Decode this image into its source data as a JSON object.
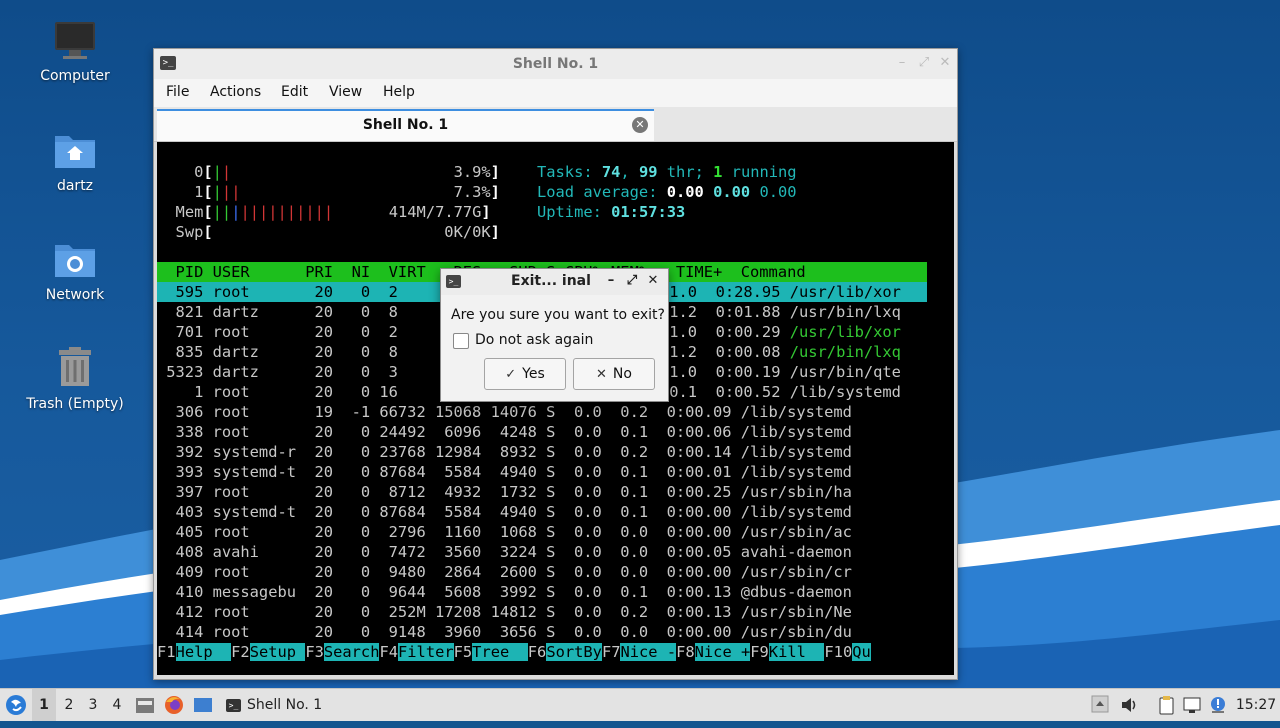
{
  "desktop": {
    "icons": [
      {
        "label": "Computer",
        "icon": "computer-icon"
      },
      {
        "label": "dartz",
        "icon": "home-folder-icon"
      },
      {
        "label": "Network",
        "icon": "network-folder-icon"
      },
      {
        "label": "Trash (Empty)",
        "icon": "trash-icon"
      }
    ]
  },
  "window": {
    "title": "Shell No. 1",
    "menu": [
      "File",
      "Actions",
      "Edit",
      "View",
      "Help"
    ],
    "tab_label": "Shell No. 1"
  },
  "htop": {
    "cpu0_label": "0",
    "cpu0_pct": "3.9%",
    "cpu1_label": "1",
    "cpu1_pct": "7.3%",
    "mem_label": "Mem",
    "mem_value": "414M/7.77G",
    "swp_label": "Swp",
    "swp_value": "0K/0K",
    "tasks_label": "Tasks: ",
    "tasks": "74",
    "threads": "99",
    "thr_label": " thr; ",
    "running": "1",
    "running_label": " running",
    "load_label": "Load average: ",
    "load1": "0.00",
    "load5": "0.00",
    "load15": "0.00",
    "uptime_label": "Uptime: ",
    "uptime": "01:57:33",
    "header": "  PID USER      PRI  NI  VIRT   RES   SHR S CPU% MEM%   TIME+  Command",
    "rows": [
      "  595 root       20   0  2",
      "  821 dartz      20   0  8",
      "  701 root       20   0  2",
      "  835 dartz      20   0  8",
      " 5323 dartz      20   0  3",
      "    1 root       20   0 16",
      "  306 root       19  -1 66732 15068 14076 S  0.0  0.2  0:00.09 /lib/systemd",
      "  338 root       20   0 24492  6096  4248 S  0.0  0.1  0:00.06 /lib/systemd",
      "  392 systemd-r  20   0 23768 12984  8932 S  0.0  0.2  0:00.14 /lib/systemd",
      "  393 systemd-t  20   0 87684  5584  4940 S  0.0  0.1  0:00.01 /lib/systemd",
      "  397 root       20   0  8712  4932  1732 S  0.0  0.1  0:00.25 /usr/sbin/ha",
      "  403 systemd-t  20   0 87684  5584  4940 S  0.0  0.1  0:00.00 /lib/systemd",
      "  405 root       20   0  2796  1160  1068 S  0.0  0.0  0:00.00 /usr/sbin/ac",
      "  408 avahi      20   0  7472  3560  3224 S  0.0  0.0  0:00.05 avahi-daemon",
      "  409 root       20   0  9480  2864  2600 S  0.0  0.0  0:00.00 /usr/sbin/cr",
      "  410 messagebu  20   0  9644  5608  3992 S  0.0  0.1  0:00.13 @dbus-daemon",
      "  412 root       20   0  252M 17208 14812 S  0.0  0.2  0:00.13 /usr/sbin/Ne",
      "  414 root       20   0  9148  3960  3656 S  0.0  0.0  0:00.00 /usr/sbin/du"
    ],
    "row_tails": [
      " 1.0  0:28.95 /usr/lib/xor",
      " 1.2  0:01.88 /usr/bin/lxq",
      " 1.0  0:00.29 /usr/lib/xor",
      " 1.2  0:00.08 /usr/bin/lxq",
      " 1.0  0:00.19 /usr/bin/qte",
      " 0.1  0:00.52 /lib/systemd"
    ],
    "fkeys": [
      {
        "key": "F1",
        "label": "Help  "
      },
      {
        "key": "F2",
        "label": "Setup "
      },
      {
        "key": "F3",
        "label": "Search"
      },
      {
        "key": "F4",
        "label": "Filter"
      },
      {
        "key": "F5",
        "label": "Tree  "
      },
      {
        "key": "F6",
        "label": "SortBy"
      },
      {
        "key": "F7",
        "label": "Nice -"
      },
      {
        "key": "F8",
        "label": "Nice +"
      },
      {
        "key": "F9",
        "label": "Kill  "
      },
      {
        "key": "F10",
        "label": "Qu"
      }
    ]
  },
  "dialog": {
    "title": "Exit... inal",
    "message": "Are you sure you want to exit?",
    "checkbox_label": "Do not ask again",
    "yes_label": "Yes",
    "no_label": "No"
  },
  "taskbar": {
    "workspaces": [
      "1",
      "2",
      "3",
      "4"
    ],
    "task_label": "Shell No. 1",
    "clock": "15:27"
  }
}
